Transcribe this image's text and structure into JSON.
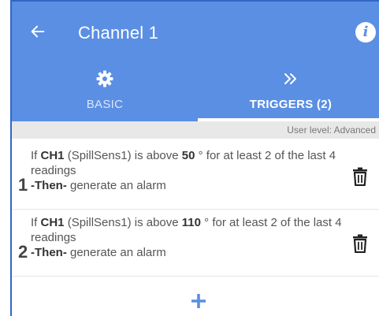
{
  "header": {
    "title": "Channel 1",
    "icons": {
      "back": "arrow-left-icon",
      "info": "info-icon"
    },
    "info_glyph": "i"
  },
  "tabs": [
    {
      "label": "BASIC",
      "icon": "gear-icon",
      "active": false
    },
    {
      "label": "TRIGGERS (2)",
      "icon": "double-chevron-right-icon",
      "active": true
    }
  ],
  "user_level": "User level: Advanced",
  "triggers": [
    {
      "index": "1",
      "prefix": "If ",
      "channel": "CH1",
      "sensor": " (SpillSens1) is above ",
      "threshold": "50",
      "condition": " ° for at least 2 of the last 4 readings",
      "then_label": "-Then-",
      "action": " generate an alarm",
      "delete_icon": "trash-icon"
    },
    {
      "index": "2",
      "prefix": "If ",
      "channel": "CH1",
      "sensor": " (SpillSens1) is above ",
      "threshold": "110",
      "condition": " ° for at least 2 of the last 4 readings",
      "then_label": "-Then-",
      "action": " generate an alarm",
      "delete_icon": "trash-icon"
    }
  ],
  "add_icon": "plus-icon",
  "colors": {
    "primary": "#5b8fe3",
    "accent": "#2f67c8",
    "text": "#555555",
    "level_bar": "#e8e8e8"
  }
}
